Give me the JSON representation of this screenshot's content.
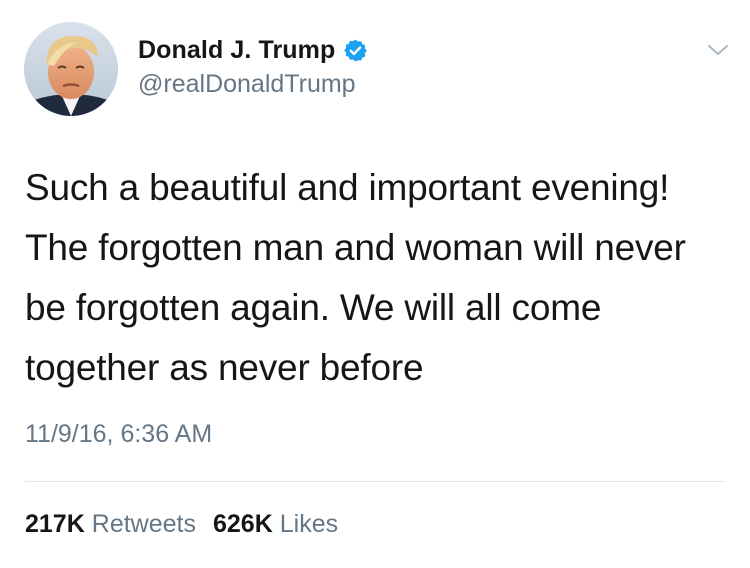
{
  "author": {
    "display_name": "Donald J. Trump",
    "handle": "@realDonaldTrump",
    "verified": true,
    "verified_color": "#1da1f2"
  },
  "tweet": {
    "text": "Such a beautiful and important evening! The forgotten man and woman will never be forgotten again. We will all come together as never before",
    "timestamp": "11/9/16, 6:36 AM"
  },
  "stats": {
    "retweets_count": "217K",
    "retweets_label": "Retweets",
    "likes_count": "626K",
    "likes_label": "Likes"
  },
  "icons": {
    "menu": "chevron-down-icon",
    "verified": "verified-badge-icon"
  },
  "colors": {
    "primary_text": "#14171a",
    "secondary_text": "#657786",
    "divider": "#e1e8ed"
  }
}
